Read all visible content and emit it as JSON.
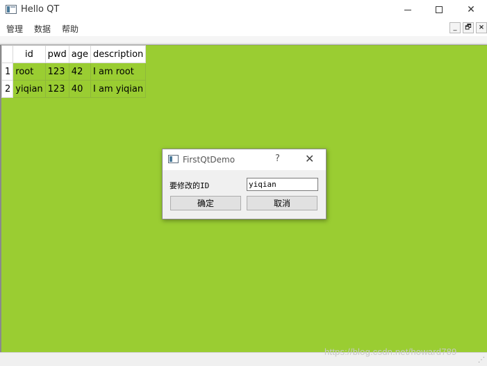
{
  "window": {
    "title": "Hello QT",
    "controls": {
      "minimize": "—",
      "maximize": "☐",
      "close": "✕"
    }
  },
  "menubar": {
    "items": [
      "管理",
      "数据",
      "帮助"
    ]
  },
  "mdi_controls": {
    "minimize": "_",
    "restore": "🗗",
    "close": "×"
  },
  "table": {
    "headers": [
      "id",
      "pwd",
      "age",
      "description"
    ],
    "rows": [
      {
        "num": "1",
        "cells": [
          "root",
          "123",
          "42",
          "I am root"
        ]
      },
      {
        "num": "2",
        "cells": [
          "yiqian",
          "123",
          "40",
          "I am yiqian"
        ]
      }
    ]
  },
  "dialog": {
    "title": "FirstQtDemo",
    "help": "?",
    "close": "✕",
    "label": "要修改的ID",
    "input_value": "yiqian",
    "ok_label": "确定",
    "cancel_label": "取消"
  },
  "watermark": "https://blog.csdn.net/howard789",
  "colors": {
    "mdi_background": "#9acd32"
  }
}
